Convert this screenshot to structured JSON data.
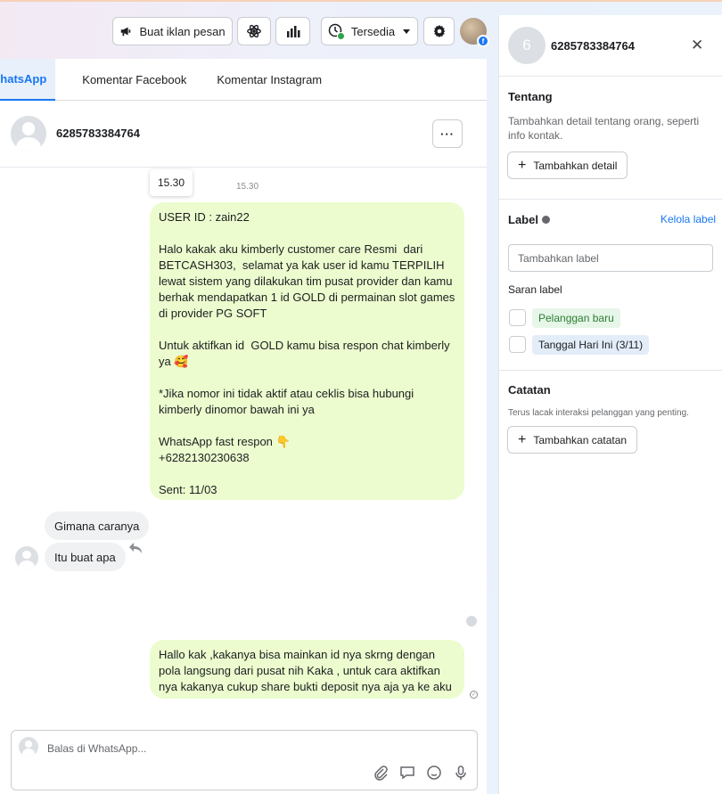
{
  "toolbar": {
    "ad_button_label": "Buat iklan pesan",
    "status_label": "Tersedia",
    "fb_badge": "f"
  },
  "tabs": [
    {
      "label": "WhatsApp",
      "active": true
    },
    {
      "label": "Komentar Facebook",
      "active": false
    },
    {
      "label": "Komentar Instagram",
      "active": false
    }
  ],
  "chat": {
    "contact_name": "6285783384764",
    "more_label": "···",
    "time_tooltip": "15.30",
    "time_small": "15.30",
    "messages": [
      {
        "from": "business",
        "text": "USER ID : zain22\n\nHalo kakak aku kimberly customer care Resmi  dari BETCASH303,  selamat ya kak user id kamu TERPILIH lewat sistem yang dilakukan tim pusat provider dan kamu berhak mendapatkan 1 id GOLD di permainan slot games di provider PG SOFT\n\nUntuk aktifkan id  GOLD kamu bisa respon chat kimberly ya 🥰\n\n*Jika nomor ini tidak aktif atau ceklis bisa hubungi kimberly dinomor bawah ini ya\n\nWhatsApp fast respon 👇\n+6282130230638\n\nSent: 11/03"
      },
      {
        "from": "customer",
        "text": "Gimana caranya"
      },
      {
        "from": "customer",
        "text": "Itu buat apa"
      },
      {
        "from": "business",
        "text": "Hallo kak ,kakanya bisa mainkan id nya skrng dengan pola langsung dari pusat nih Kaka , untuk cara aktifkan nya kakanya cukup share bukti deposit nya aja ya ke aku"
      }
    ]
  },
  "composer": {
    "placeholder": "Balas di WhatsApp..."
  },
  "contact_panel": {
    "avatar_number": "6",
    "name": "6285783384764",
    "close_label": "✕",
    "about": {
      "title": "Tentang",
      "description": "Tambahkan detail tentang orang, seperti info kontak.",
      "button_label": "Tambahkan detail"
    },
    "labels": {
      "title": "Label",
      "manage_link": "Kelola label",
      "input_placeholder": "Tambahkan label",
      "suggestions_title": "Saran label",
      "suggestions": [
        {
          "label": "Pelanggan baru",
          "color": "#e6f6e9",
          "text_color": "#2e7d32"
        },
        {
          "label": "Tanggal Hari Ini (3/11)",
          "color": "#e3edf9",
          "text_color": "#1c1e21"
        }
      ]
    },
    "notes": {
      "title": "Catatan",
      "description": "Terus lacak interaksi pelanggan yang penting.",
      "button_label": "Tambahkan catatan"
    }
  },
  "colors": {
    "accent": "#1877f2",
    "outgoing_bubble": "#ecfcce",
    "incoming_bubble": "#f0f1f3"
  }
}
